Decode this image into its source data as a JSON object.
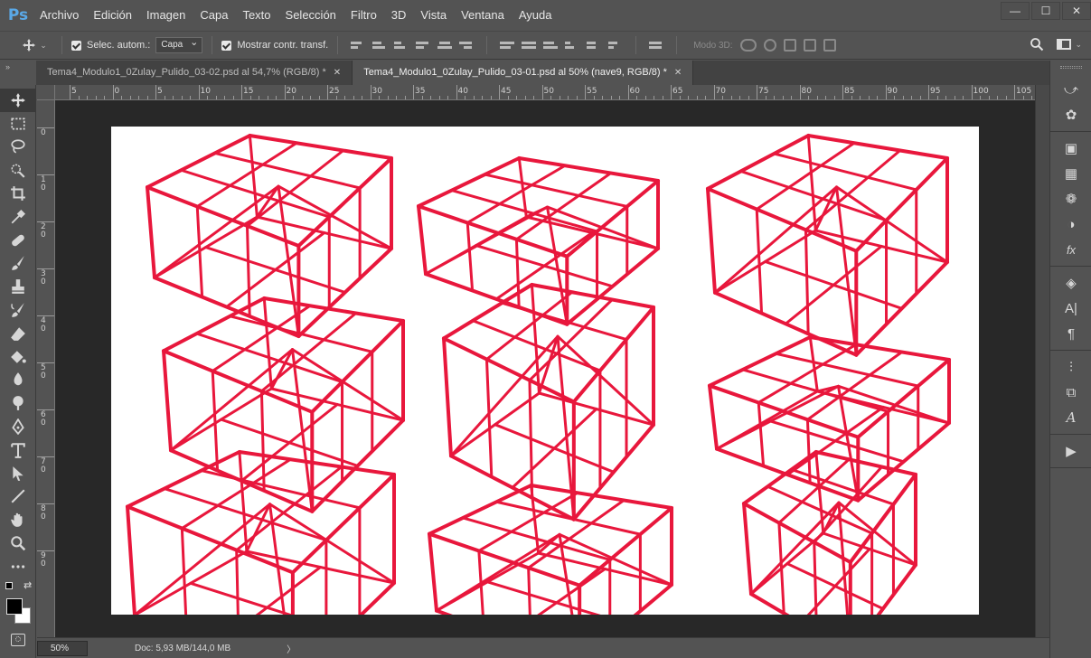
{
  "app": {
    "logo": "Ps"
  },
  "menu": [
    "Archivo",
    "Edición",
    "Imagen",
    "Capa",
    "Texto",
    "Selección",
    "Filtro",
    "3D",
    "Vista",
    "Ventana",
    "Ayuda"
  ],
  "window_controls": {
    "minimize": "—",
    "maximize": "☐",
    "close": "✕"
  },
  "options": {
    "auto_select_label": "Selec. autom.:",
    "auto_select_value": "Capa",
    "show_transform_label": "Mostrar contr. transf.",
    "mode_3d_label": "Modo 3D:"
  },
  "tabs": [
    {
      "title": "Tema4_Modulo1_0Zulay_Pulido_03-02.psd al 54,7% (RGB/8) *",
      "close": "✕",
      "active": false
    },
    {
      "title": "Tema4_Modulo1_0Zulay_Pulido_03-01.psd al 50% (nave9, RGB/8) *",
      "close": "✕",
      "active": true
    }
  ],
  "ruler_top_labels": [
    "5",
    "0",
    "5",
    "10",
    "15",
    "20",
    "25",
    "30",
    "35",
    "40",
    "45",
    "50",
    "55",
    "60",
    "65",
    "70",
    "75",
    "80",
    "85",
    "90",
    "95",
    "100",
    "105"
  ],
  "ruler_left_labels": [
    "0",
    "1\n0",
    "2\n0",
    "3\n0",
    "4\n0",
    "5\n0",
    "6\n0",
    "7\n0",
    "8\n0",
    "9\n0"
  ],
  "status": {
    "zoom": "50%",
    "doc": "Doc: 5,93 MB/144,0 MB",
    "arrow": "〉"
  },
  "canvas": {
    "stroke_color": "#e8173c",
    "doc_background": "#ffffff"
  },
  "right_panel_icons": [
    "history-icon",
    "color-icon",
    "libraries-icon",
    "swatches-icon",
    "brush-presets-icon",
    "adjustments-icon",
    "styles-icon",
    "layers-icon",
    "character-icon",
    "paragraph-icon",
    "properties-icon",
    "channels-icon",
    "glyphs-icon",
    "actions-icon"
  ],
  "tools": [
    "move-icon",
    "marquee-icon",
    "lasso-icon",
    "quick-select-icon",
    "crop-icon",
    "eyedropper-icon",
    "healing-icon",
    "brush-icon",
    "clone-stamp-icon",
    "history-brush-icon",
    "eraser-icon",
    "paint-bucket-icon",
    "blur-icon",
    "dodge-icon",
    "pen-icon",
    "type-icon",
    "path-select-icon",
    "line-icon",
    "hand-icon",
    "zoom-icon",
    "more-tools-icon"
  ]
}
